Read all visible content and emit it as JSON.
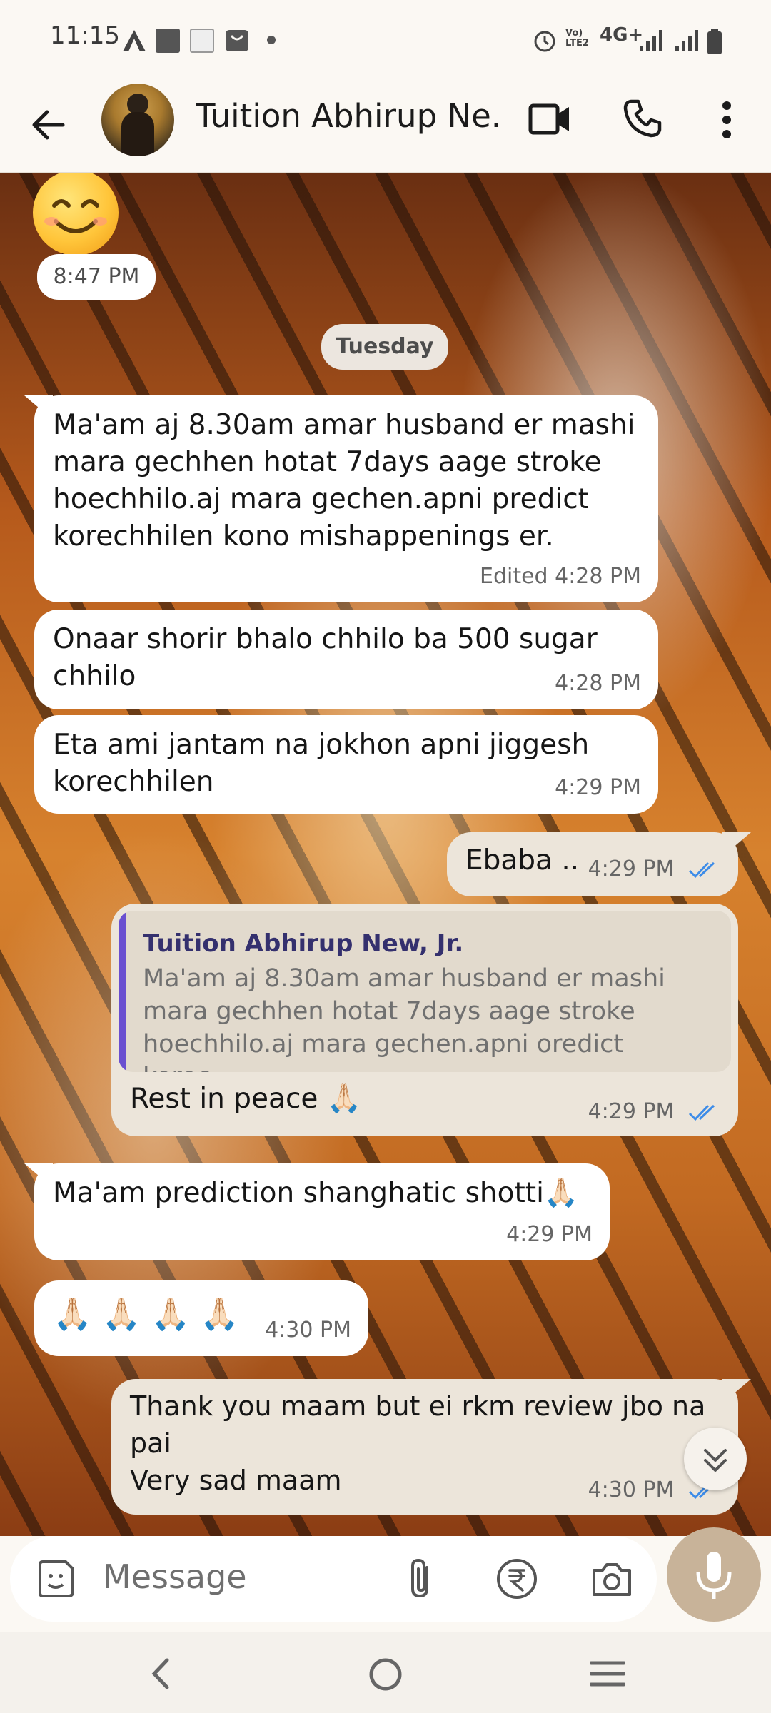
{
  "status": {
    "time": "11:15",
    "network": "4G+",
    "volte": "Vo) LTE2",
    "icons": [
      "text-a-icon",
      "square-icon",
      "news-icon",
      "bag-icon",
      "dot-icon",
      "alarm-icon",
      "signal-icon",
      "signal-icon",
      "battery-icon"
    ]
  },
  "header": {
    "contact_name": "Tuition Abhirup Ne...",
    "icons": [
      "back-arrow-icon",
      "video-call-icon",
      "phone-icon",
      "more-vert-icon"
    ]
  },
  "chat": {
    "first_time": "8:47 PM",
    "day_separator": "Tuesday",
    "messages": [
      {
        "text": "Ma'am aj 8.30am amar husband er mashi\nmara gechhen hotat 7days aage stroke\nhoechhilo.aj mara gechen.apni predict\nkorechhilen kono mishappenings er.",
        "meta": "Edited 4:28 PM"
      },
      {
        "text": "Onaar shorir bhalo chhilo ba 500 sugar\nchhilo",
        "meta": "4:28 PM"
      },
      {
        "text": "Eta ami jantam na jokhon apni jiggesh\nkorechhilen",
        "meta": "4:29 PM"
      },
      {
        "text": "Ebaba ..",
        "meta": "4:29 PM"
      },
      {
        "reply_name": "Tuition Abhirup New, Jr.",
        "reply_text": "Ma'am aj 8.30am amar husband er mashi\nmara gechhen hotat 7days aage stroke\nhoechhilo.aj mara gechen.apni oredict korec...",
        "text": "Rest in peace 🙏🏻",
        "meta": "4:29 PM"
      },
      {
        "text": "Ma'am prediction shanghatic shotti🙏🏻",
        "meta": "4:29 PM"
      },
      {
        "text": "🙏🏻 🙏🏻 🙏🏻 🙏🏻",
        "meta": "4:30 PM"
      },
      {
        "text": "Thank you maam but ei rkm review jbo na\npai\nVery sad maam",
        "meta": "4:30 PM"
      }
    ]
  },
  "input": {
    "placeholder": "Message",
    "icons": [
      "sticker-icon",
      "attach-icon",
      "rupee-icon",
      "camera-icon",
      "mic-icon"
    ]
  },
  "colors": {
    "incoming": "#ffffff",
    "outgoing": "#ece5da",
    "tick_blue": "#3d8ce8",
    "mic_button": "#c8b399"
  }
}
